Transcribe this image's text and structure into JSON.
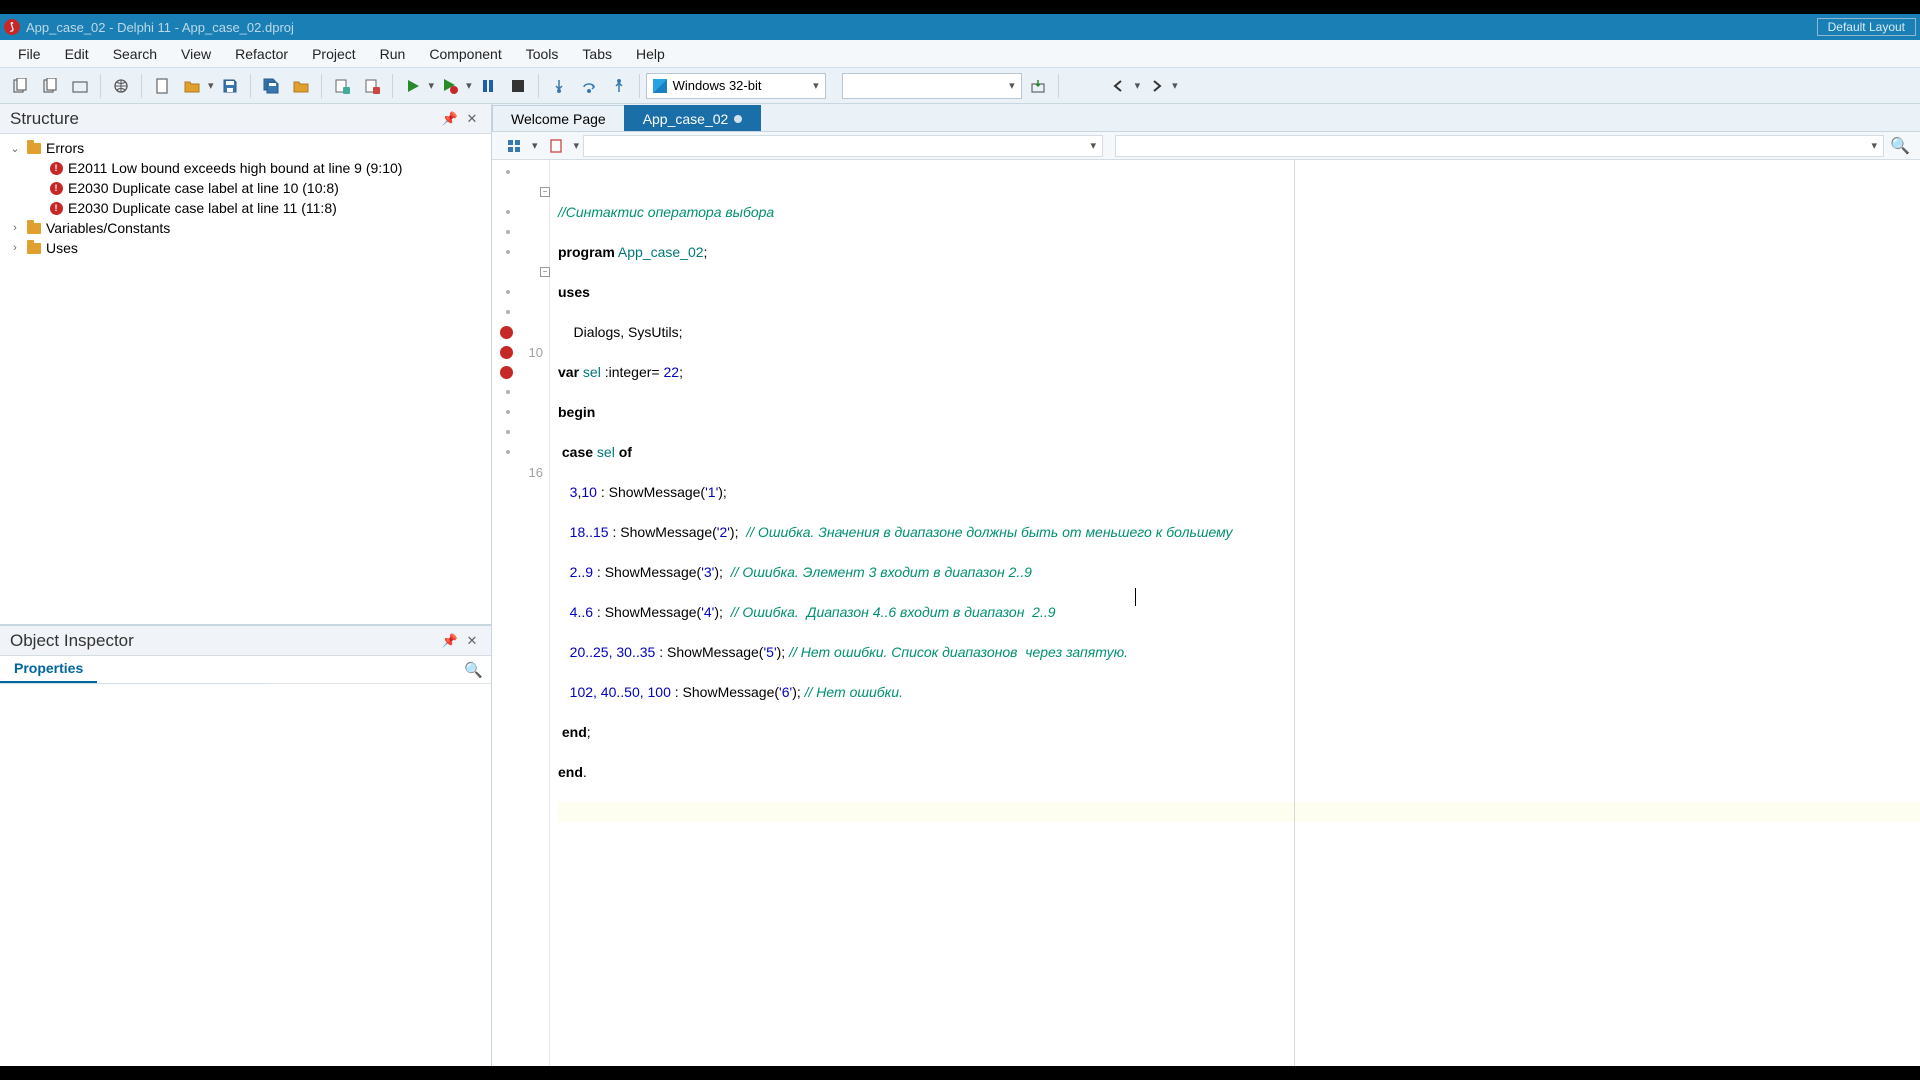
{
  "titlebar": {
    "text": "App_case_02 - Delphi 11 - App_case_02.dproj",
    "layout_button": "Default Layout"
  },
  "menubar": [
    "File",
    "Edit",
    "Search",
    "View",
    "Refactor",
    "Project",
    "Run",
    "Component",
    "Tools",
    "Tabs",
    "Help"
  ],
  "toolbar": {
    "platform": "Windows 32-bit"
  },
  "structure": {
    "title": "Structure",
    "errors_label": "Errors",
    "errors": [
      "E2011 Low bound exceeds high bound at line 9 (9:10)",
      "E2030 Duplicate case label at line 10 (10:8)",
      "E2030 Duplicate case label at line 11 (11:8)"
    ],
    "nodes": [
      "Variables/Constants",
      "Uses"
    ]
  },
  "object_inspector": {
    "title": "Object Inspector",
    "tab": "Properties"
  },
  "tabs": {
    "welcome": "Welcome Page",
    "active": "App_case_02"
  },
  "gutter": {
    "line10": "10",
    "line16": "16"
  },
  "code": {
    "l1_cmt": "//Синтактис оператора выбора",
    "l2_kw1": "program",
    "l2_id": " App_case_02",
    "l2_p": ";",
    "l3_kw": "uses",
    "l4": "    Dialogs, SysUtils;",
    "l5_kw": "var",
    "l5_id": " sel ",
    "l5_p1": ":",
    "l5_ty": "integer",
    "l5_p2": "= ",
    "l5_num": "22",
    "l5_p3": ";",
    "l6_kw": "begin",
    "l7_kw1": "case",
    "l7_id": " sel ",
    "l7_kw2": "of",
    "l8_n1": "3",
    "l8_c": ",",
    "l8_n2": "10",
    "l8_p": " : ShowMessage(",
    "l8_s": "'1'",
    "l8_e": ");",
    "l9_n": "18..15",
    "l9_p": " : ShowMessage(",
    "l9_s": "'2'",
    "l9_e": ");  ",
    "l9_cmt": "// Ошибка. Значения в диапазоне должны быть от меньшего к большему",
    "l10_n": "2..9",
    "l10_p": " : ShowMessage(",
    "l10_s": "'3'",
    "l10_e": ");  ",
    "l10_cmt": "// Ошибка. Элемент 3 входит в диапазон 2..9",
    "l11_n": "4..6",
    "l11_p": " : ShowMessage(",
    "l11_s": "'4'",
    "l11_e": ");  ",
    "l11_cmt": "// Ошибка.  Диапазон 4..6 входит в диапазон  2..9",
    "l12_n": "20..25, 30..35",
    "l12_p": " : ShowMessage(",
    "l12_s": "'5'",
    "l12_e": "); ",
    "l12_cmt": "// Нет ошибки. Список диапазонов  через запятую.",
    "l13_n": "102, 40..50, 100",
    "l13_p": " : ShowMessage(",
    "l13_s": "'6'",
    "l13_e": "); ",
    "l13_cmt": "// Нет ошибки.",
    "l14_kw": "end",
    "l14_p": ";",
    "l15_kw": "end",
    "l15_p": "."
  }
}
